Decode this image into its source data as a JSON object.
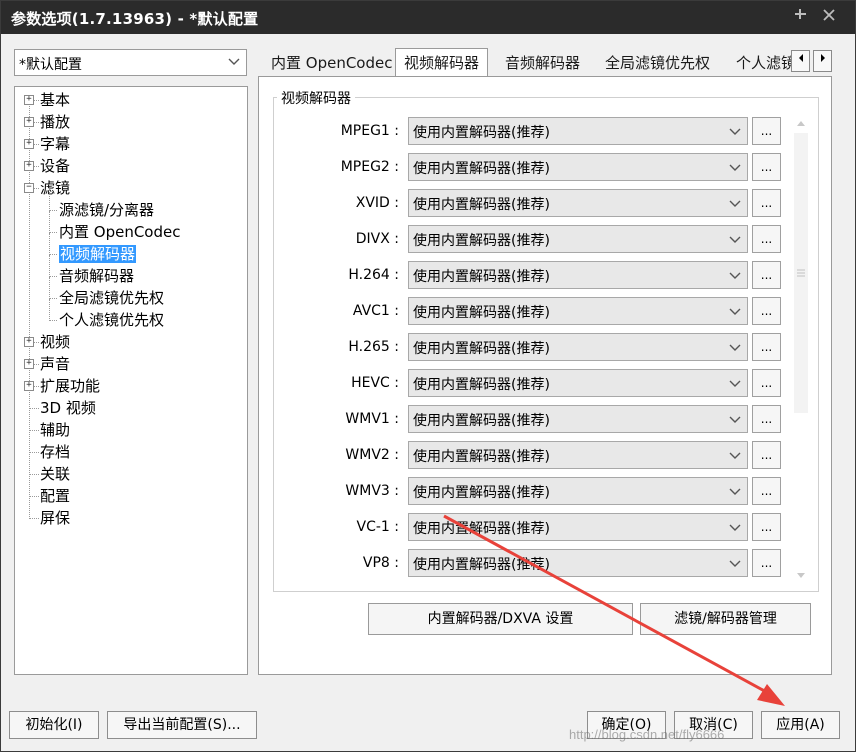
{
  "window": {
    "title": "参数选项(1.7.13963) - *默认配置"
  },
  "profile": {
    "value": "*默认配置"
  },
  "tree": [
    {
      "label": "基本",
      "expand": "+"
    },
    {
      "label": "播放",
      "expand": "+"
    },
    {
      "label": "字幕",
      "expand": "+"
    },
    {
      "label": "设备",
      "expand": "+"
    },
    {
      "label": "滤镜",
      "expand": "-"
    },
    {
      "label": "源滤镜/分离器"
    },
    {
      "label": "内置 OpenCodec"
    },
    {
      "label": "视频解码器"
    },
    {
      "label": "音频解码器"
    },
    {
      "label": "全局滤镜优先权"
    },
    {
      "label": "个人滤镜优先权"
    },
    {
      "label": "视频",
      "expand": "+"
    },
    {
      "label": "声音",
      "expand": "+"
    },
    {
      "label": "扩展功能",
      "expand": "+"
    },
    {
      "label": "3D 视频"
    },
    {
      "label": "辅助"
    },
    {
      "label": "存档"
    },
    {
      "label": "关联"
    },
    {
      "label": "配置"
    },
    {
      "label": "屏保"
    }
  ],
  "tabs": [
    "内置 OpenCodec",
    "视频解码器",
    "音频解码器",
    "全局滤镜优先权",
    "个人滤镜"
  ],
  "group": {
    "title": "视频解码器"
  },
  "decoders": [
    {
      "label": "MPEG1 :",
      "value": "使用内置解码器(推荐)"
    },
    {
      "label": "MPEG2 :",
      "value": "使用内置解码器(推荐)"
    },
    {
      "label": "XVID :",
      "value": "使用内置解码器(推荐)"
    },
    {
      "label": "DIVX :",
      "value": "使用内置解码器(推荐)"
    },
    {
      "label": "H.264 :",
      "value": "使用内置解码器(推荐)"
    },
    {
      "label": "AVC1 :",
      "value": "使用内置解码器(推荐)"
    },
    {
      "label": "H.265 :",
      "value": "使用内置解码器(推荐)"
    },
    {
      "label": "HEVC :",
      "value": "使用内置解码器(推荐)"
    },
    {
      "label": "WMV1 :",
      "value": "使用内置解码器(推荐)"
    },
    {
      "label": "WMV2 :",
      "value": "使用内置解码器(推荐)"
    },
    {
      "label": "WMV3 :",
      "value": "使用内置解码器(推荐)"
    },
    {
      "label": "VC-1 :",
      "value": "使用内置解码器(推荐)"
    },
    {
      "label": "VP8 :",
      "value": "使用内置解码器(推荐)"
    }
  ],
  "more_label": "...",
  "buttons": {
    "dxva": "内置解码器/DXVA 设置",
    "filter_mgr": "滤镜/解码器管理",
    "init": "初始化(I)",
    "export": "导出当前配置(S)...",
    "ok": "确定(O)",
    "cancel": "取消(C)",
    "apply": "应用(A)"
  },
  "watermark": "http://blog.csdn.net/fly6666",
  "colors": {
    "titlebar": "#2b2b2b",
    "selection": "#3399ff",
    "arrow": "#e8423a"
  }
}
